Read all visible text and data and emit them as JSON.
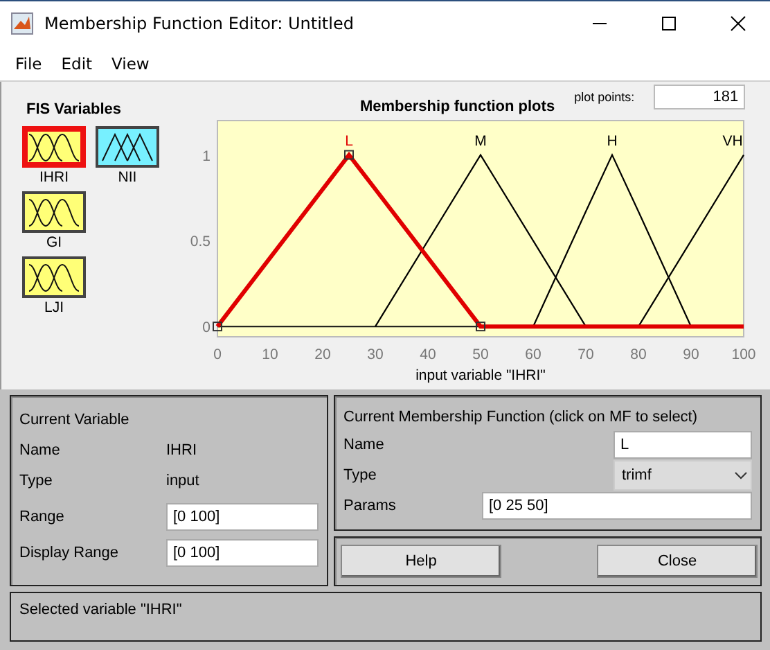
{
  "window": {
    "title": "Membership Function Editor: Untitled"
  },
  "menu": [
    "File",
    "Edit",
    "View"
  ],
  "fis_variables": {
    "title": "FIS Variables",
    "items": [
      {
        "label": "IHRI",
        "kind": "input",
        "selected": true
      },
      {
        "label": "NII",
        "kind": "output",
        "selected": false
      },
      {
        "label": "GI",
        "kind": "input",
        "selected": false
      },
      {
        "label": "LJI",
        "kind": "input",
        "selected": false
      }
    ]
  },
  "plot": {
    "plot_points_label": "plot points:",
    "plot_points": "181",
    "chart_data": {
      "type": "line",
      "title": "Membership function plots",
      "xlabel": "input variable \"IHRI\"",
      "x": [
        0,
        25,
        30,
        50,
        60,
        70,
        75,
        80,
        90,
        100
      ],
      "series": [
        {
          "name": "L",
          "color": "#e00000",
          "values": [
            0,
            1,
            0.8,
            0,
            0,
            0,
            0,
            0,
            0,
            0
          ]
        },
        {
          "name": "M",
          "color": "#000000",
          "values": [
            null,
            null,
            0,
            1,
            0.5,
            0,
            null,
            null,
            null,
            null
          ]
        },
        {
          "name": "H",
          "color": "#000000",
          "values": [
            null,
            null,
            null,
            null,
            0,
            0.67,
            1,
            0.67,
            0,
            null
          ]
        },
        {
          "name": "VH",
          "color": "#000000",
          "values": [
            null,
            null,
            null,
            null,
            null,
            null,
            null,
            0,
            0.5,
            1
          ]
        }
      ],
      "xlim": [
        0,
        100
      ],
      "ylim": [
        -0.06,
        1.2
      ],
      "xticks": [
        0,
        10,
        20,
        30,
        40,
        50,
        60,
        70,
        80,
        90,
        100
      ],
      "yticks": [
        0,
        0.5,
        1
      ]
    },
    "functions": [
      {
        "selected": true
      },
      {
        "selected": false
      },
      {
        "selected": false
      },
      {
        "selected": false
      }
    ]
  },
  "current_variable": {
    "title": "Current Variable",
    "name_label": "Name",
    "name": "IHRI",
    "type_label": "Type",
    "type": "input",
    "range_label": "Range",
    "range": "[0 100]",
    "display_range_label": "Display Range",
    "display_range": "[0 100]"
  },
  "current_mf": {
    "title": "Current Membership Function (click on MF to select)",
    "name_label": "Name",
    "name": "L",
    "type_label": "Type",
    "type": "trimf",
    "params_label": "Params",
    "params": "[0 25 50]"
  },
  "buttons": [
    "Help",
    "Close"
  ],
  "status": "Selected variable \"IHRI\""
}
